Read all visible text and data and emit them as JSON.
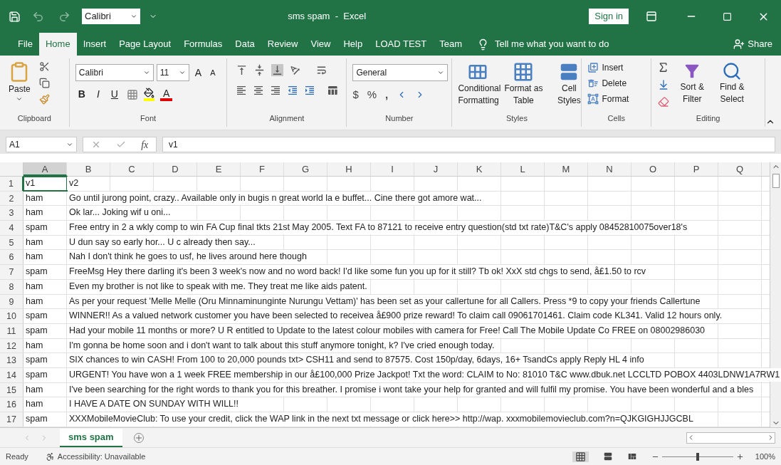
{
  "window": {
    "title": "sms spam  -  Excel",
    "font_box": "Calibri",
    "sign_in": "Sign in"
  },
  "menu_tabs": [
    {
      "label": "File",
      "selected": false
    },
    {
      "label": "Home",
      "selected": true
    },
    {
      "label": "Insert",
      "selected": false
    },
    {
      "label": "Page Layout",
      "selected": false
    },
    {
      "label": "Formulas",
      "selected": false
    },
    {
      "label": "Data",
      "selected": false
    },
    {
      "label": "Review",
      "selected": false
    },
    {
      "label": "View",
      "selected": false
    },
    {
      "label": "Help",
      "selected": false
    },
    {
      "label": "LOAD TEST",
      "selected": false
    },
    {
      "label": "Team",
      "selected": false
    }
  ],
  "tell_me": "Tell me what you want to do",
  "share": "Share",
  "ribbon": {
    "clipboard": {
      "label": "Clipboard",
      "paste": "Paste"
    },
    "font": {
      "label": "Font",
      "family": "Calibri",
      "size": "11",
      "grow": "A",
      "shrink": "A",
      "bold": "B",
      "italic": "I",
      "underline": "U",
      "font_color": "A"
    },
    "alignment": {
      "label": "Alignment"
    },
    "number": {
      "label": "Number",
      "format": "General",
      "currency": "$",
      "percent": "%",
      "comma": ","
    },
    "styles": {
      "label": "Styles",
      "buttons": [
        "Conditional Formatting",
        "Format as Table",
        "Cell Styles"
      ]
    },
    "cells": {
      "label": "Cells",
      "buttons": [
        "Insert",
        "Delete",
        "Format"
      ]
    },
    "editing": {
      "label": "Editing",
      "buttons": [
        "Sort & Filter",
        "Find & Select"
      ]
    }
  },
  "formula_bar": {
    "name_box": "A1",
    "fx": "fx",
    "value": "v1"
  },
  "sheet": {
    "columns": [
      "A",
      "B",
      "C",
      "D",
      "E",
      "F",
      "G",
      "H",
      "I",
      "J",
      "K",
      "L",
      "M",
      "N",
      "O",
      "P",
      "Q"
    ],
    "rows": [
      {
        "number": "1",
        "v1": "v1",
        "v2": "v2"
      },
      {
        "number": "2",
        "v1": "ham",
        "v2": "Go until jurong point, crazy.. Available only in bugis n great world la e buffet... Cine there got amore wat..."
      },
      {
        "number": "3",
        "v1": "ham",
        "v2": "Ok lar... Joking wif u oni..."
      },
      {
        "number": "4",
        "v1": "spam",
        "v2": "Free entry in 2 a wkly comp to win FA Cup final tkts 21st May 2005. Text FA to 87121 to receive entry question(std txt rate)T&C's apply 08452810075over18's"
      },
      {
        "number": "5",
        "v1": "ham",
        "v2": "U dun say so early hor... U c already then say..."
      },
      {
        "number": "6",
        "v1": "ham",
        "v2": "Nah I don't think he goes to usf, he lives around here though"
      },
      {
        "number": "7",
        "v1": "spam",
        "v2": "FreeMsg Hey there darling it's been 3 week's now and no word back! I'd like some fun you up for it still? Tb ok! XxX std chgs to send, å£1.50 to rcv"
      },
      {
        "number": "8",
        "v1": "ham",
        "v2": "Even my brother is not like to speak with me. They treat me like aids patent."
      },
      {
        "number": "9",
        "v1": "ham",
        "v2": "As per your request 'Melle Melle (Oru Minnaminunginte Nurungu Vettam)' has been set as your callertune for all Callers. Press *9 to copy your friends Callertune"
      },
      {
        "number": "10",
        "v1": "spam",
        "v2": "WINNER!! As a valued network customer you have been selected to receivea å£900 prize reward! To claim call 09061701461. Claim code KL341. Valid 12 hours only."
      },
      {
        "number": "11",
        "v1": "spam",
        "v2": "Had your mobile 11 months or more? U R entitled to Update to the latest colour mobiles with camera for Free! Call The Mobile Update Co FREE on 08002986030"
      },
      {
        "number": "12",
        "v1": "ham",
        "v2": "I'm gonna be home soon and i don't want to talk about this stuff anymore tonight, k? I've cried enough today."
      },
      {
        "number": "13",
        "v1": "spam",
        "v2": "SIX chances to win CASH! From 100 to 20,000 pounds txt> CSH11 and send to 87575. Cost 150p/day, 6days, 16+ TsandCs apply Reply HL 4 info"
      },
      {
        "number": "14",
        "v1": "spam",
        "v2": "URGENT! You have won a 1 week FREE membership in our å£100,000 Prize Jackpot! Txt the word: CLAIM to No: 81010 T&C www.dbuk.net LCCLTD POBOX 4403LDNW1A7RW1"
      },
      {
        "number": "15",
        "v1": "ham",
        "v2": "I've been searching for the right words to thank you for this breather. I promise i wont take your help for granted and will fulfil my promise. You have been wonderful and a bles"
      },
      {
        "number": "16",
        "v1": "ham",
        "v2": "I HAVE A DATE ON SUNDAY WITH WILL!!"
      },
      {
        "number": "17",
        "v1": "spam",
        "v2": "XXXMobileMovieClub: To use your credit, click the WAP link in the next txt message or click here>> http://wap. xxxmobilemovieclub.com?n=QJKGIGHJJGCBL"
      }
    ]
  },
  "sheet_tabs": [
    {
      "label": "sms spam",
      "selected": true
    }
  ],
  "status_bar": {
    "ready": "Ready",
    "accessibility": "Accessibility: Unavailable",
    "zoom": {
      "level": 0.5,
      "reading": "100%"
    }
  }
}
